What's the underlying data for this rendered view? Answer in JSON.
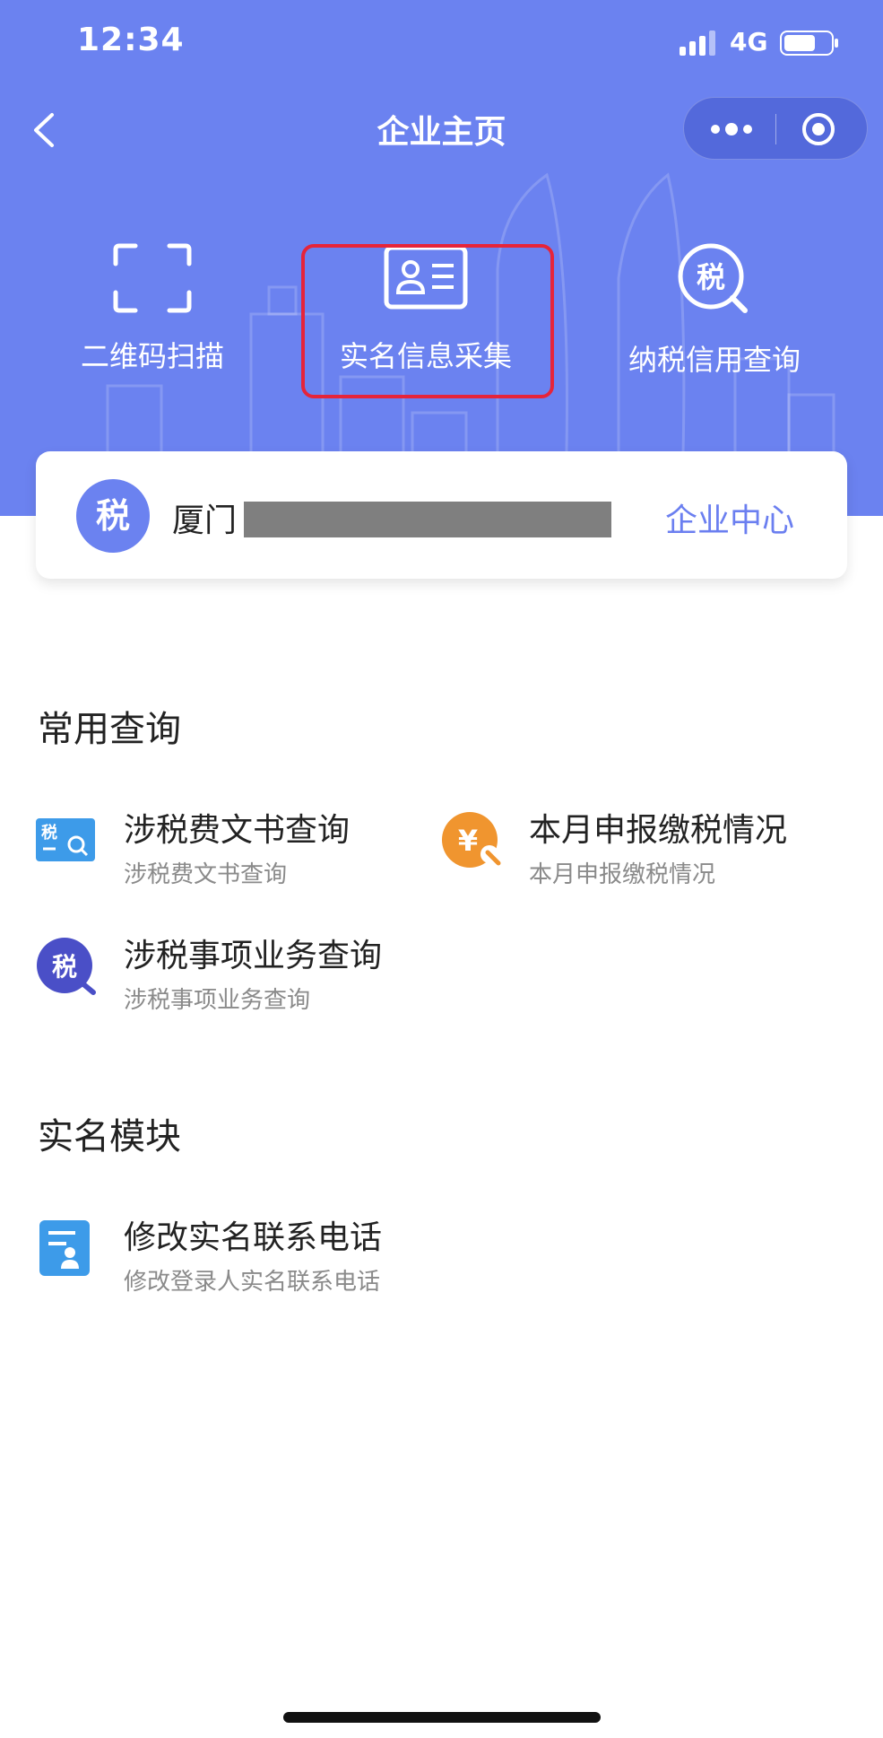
{
  "status": {
    "time": "12:34",
    "network": "4G"
  },
  "nav": {
    "title": "企业主页"
  },
  "quick_actions": [
    {
      "label": "二维码扫描",
      "icon": "scan-icon"
    },
    {
      "label": "实名信息采集",
      "icon": "id-card-icon"
    },
    {
      "label": "纳税信用查询",
      "icon": "tax-search-icon",
      "glyph": "税"
    }
  ],
  "company_card": {
    "badge": "税",
    "name": "厦门",
    "link": "企业中心"
  },
  "common_query": {
    "title": "常用查询",
    "items": [
      {
        "title": "涉税费文书查询",
        "subtitle": "涉税费文书查询",
        "icon": "tax-doc-search-icon",
        "glyph": "税"
      },
      {
        "title": "本月申报缴税情况",
        "subtitle": "本月申报缴税情况",
        "icon": "yuan-search-icon",
        "glyph": "¥"
      },
      {
        "title": "涉税事项业务查询",
        "subtitle": "涉税事项业务查询",
        "icon": "tax-matter-search-icon",
        "glyph": "税"
      }
    ]
  },
  "realname": {
    "title": "实名模块",
    "items": [
      {
        "title": "修改实名联系电话",
        "subtitle": "修改登录人实名联系电话",
        "icon": "contact-form-icon"
      }
    ]
  },
  "colors": {
    "header": "#6b82f0",
    "accent": "#6b7ff0",
    "highlight": "#e6243a"
  }
}
